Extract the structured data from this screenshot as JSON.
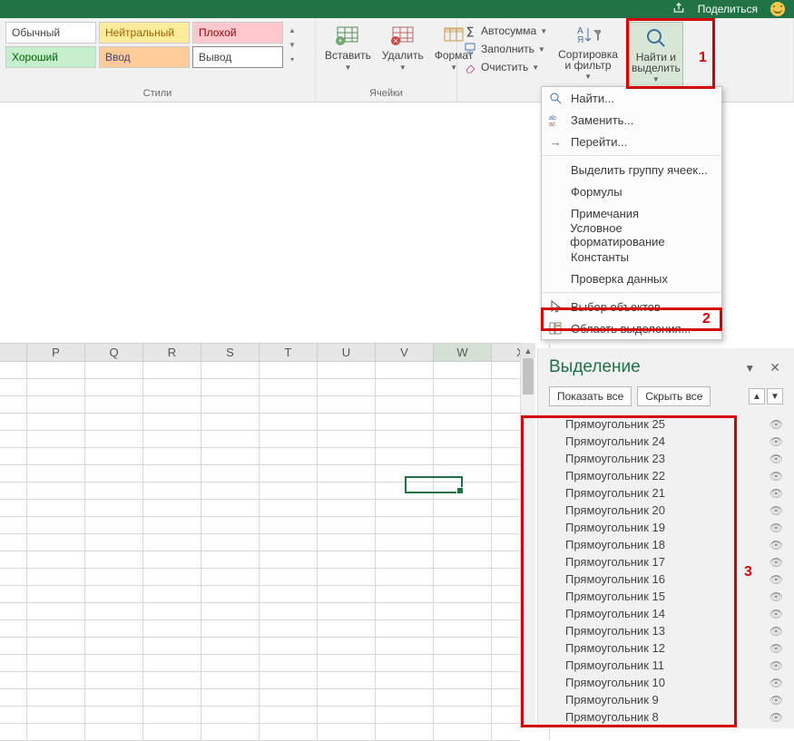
{
  "titlebar": {
    "share": "Поделиться"
  },
  "styles": {
    "label": "Стили",
    "items": [
      "Обычный",
      "Нейтральный",
      "Плохой",
      "Хороший",
      "Ввод",
      "Вывод"
    ]
  },
  "cells": {
    "label": "Ячейки",
    "insert": "Вставить",
    "delete": "Удалить",
    "format": "Формат"
  },
  "editing": {
    "autosum": "Автосумма",
    "fill": "Заполнить",
    "clear": "Очистить",
    "sort": "Сортировка\nи фильтр",
    "find": "Найти и\nвыделить"
  },
  "annotations": {
    "one": "1",
    "two": "2",
    "three": "3"
  },
  "dropdown": {
    "find": "Найти...",
    "replace": "Заменить...",
    "goto": "Перейти...",
    "special": "Выделить группу ячеек...",
    "formulas": "Формулы",
    "comments": "Примечания",
    "condfmt": "Условное форматирование",
    "constants": "Константы",
    "validation": "Проверка данных",
    "selobj": "Выбор объектов",
    "selpane": "Область выделения..."
  },
  "columns": [
    "P",
    "Q",
    "R",
    "S",
    "T",
    "U",
    "V",
    "W",
    "X"
  ],
  "selected_col": "W",
  "pane": {
    "title": "Выделение",
    "show_all": "Показать все",
    "hide_all": "Скрыть все",
    "shapes": [
      "Прямоугольник 25",
      "Прямоугольник 24",
      "Прямоугольник 23",
      "Прямоугольник 22",
      "Прямоугольник 21",
      "Прямоугольник 20",
      "Прямоугольник 19",
      "Прямоугольник 18",
      "Прямоугольник 17",
      "Прямоугольник 16",
      "Прямоугольник 15",
      "Прямоугольник 14",
      "Прямоугольник 13",
      "Прямоугольник 12",
      "Прямоугольник 11",
      "Прямоугольник 10",
      "Прямоугольник 9",
      "Прямоугольник 8"
    ]
  }
}
